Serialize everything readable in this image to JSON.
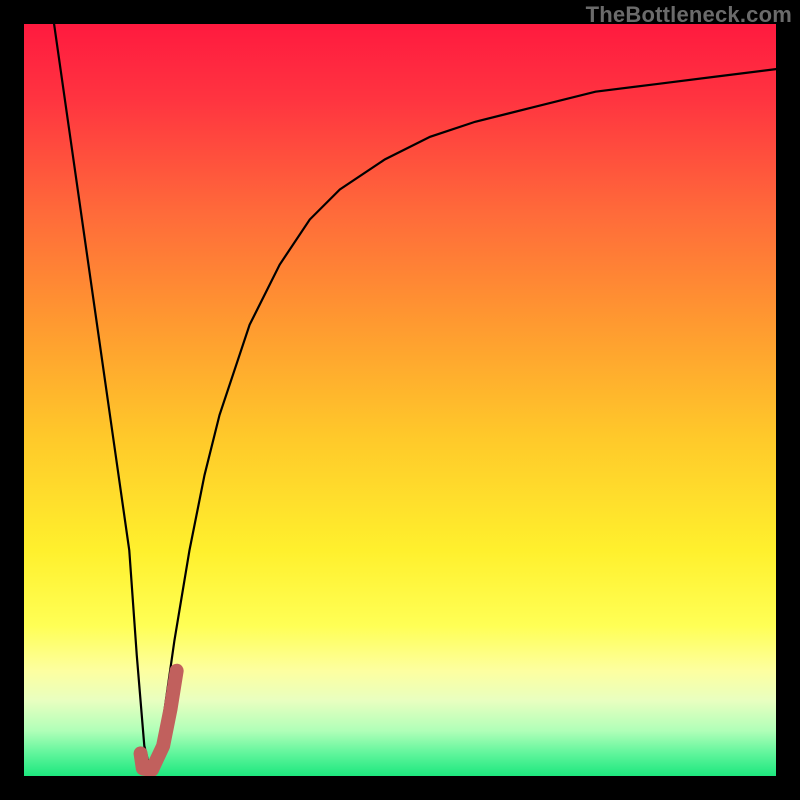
{
  "watermark": "TheBottleneck.com",
  "colors": {
    "frame": "#000000",
    "gradient_stops": [
      {
        "offset": 0.0,
        "color": "#ff1a3f"
      },
      {
        "offset": 0.1,
        "color": "#ff3440"
      },
      {
        "offset": 0.25,
        "color": "#ff6a3a"
      },
      {
        "offset": 0.4,
        "color": "#ff9a30"
      },
      {
        "offset": 0.55,
        "color": "#ffc92a"
      },
      {
        "offset": 0.7,
        "color": "#fff02d"
      },
      {
        "offset": 0.8,
        "color": "#ffff55"
      },
      {
        "offset": 0.86,
        "color": "#fdffa0"
      },
      {
        "offset": 0.9,
        "color": "#e8ffc0"
      },
      {
        "offset": 0.94,
        "color": "#b0ffb8"
      },
      {
        "offset": 0.97,
        "color": "#60f59c"
      },
      {
        "offset": 1.0,
        "color": "#1de77e"
      }
    ],
    "curve": "#000000",
    "tick_mark": "#c1605d"
  },
  "chart_data": {
    "type": "line",
    "title": "",
    "xlabel": "",
    "ylabel": "",
    "xlim": [
      0,
      100
    ],
    "ylim": [
      0,
      100
    ],
    "grid": false,
    "legend": false,
    "series": [
      {
        "name": "bottleneck-curve",
        "x": [
          4,
          6,
          8,
          10,
          12,
          14,
          15,
          16,
          17,
          18,
          20,
          22,
          24,
          26,
          28,
          30,
          34,
          38,
          42,
          48,
          54,
          60,
          68,
          76,
          84,
          92,
          100
        ],
        "y": [
          100,
          86,
          72,
          58,
          44,
          30,
          16,
          4,
          0,
          4,
          18,
          30,
          40,
          48,
          54,
          60,
          68,
          74,
          78,
          82,
          85,
          87,
          89,
          91,
          92,
          93,
          94
        ]
      }
    ],
    "marker": {
      "name": "optimal-range-tick",
      "x": [
        15.5,
        15.8,
        17.0,
        18.5,
        19.5,
        20.3
      ],
      "y": [
        3.0,
        1.0,
        0.8,
        4.0,
        9.0,
        14.0
      ]
    }
  }
}
